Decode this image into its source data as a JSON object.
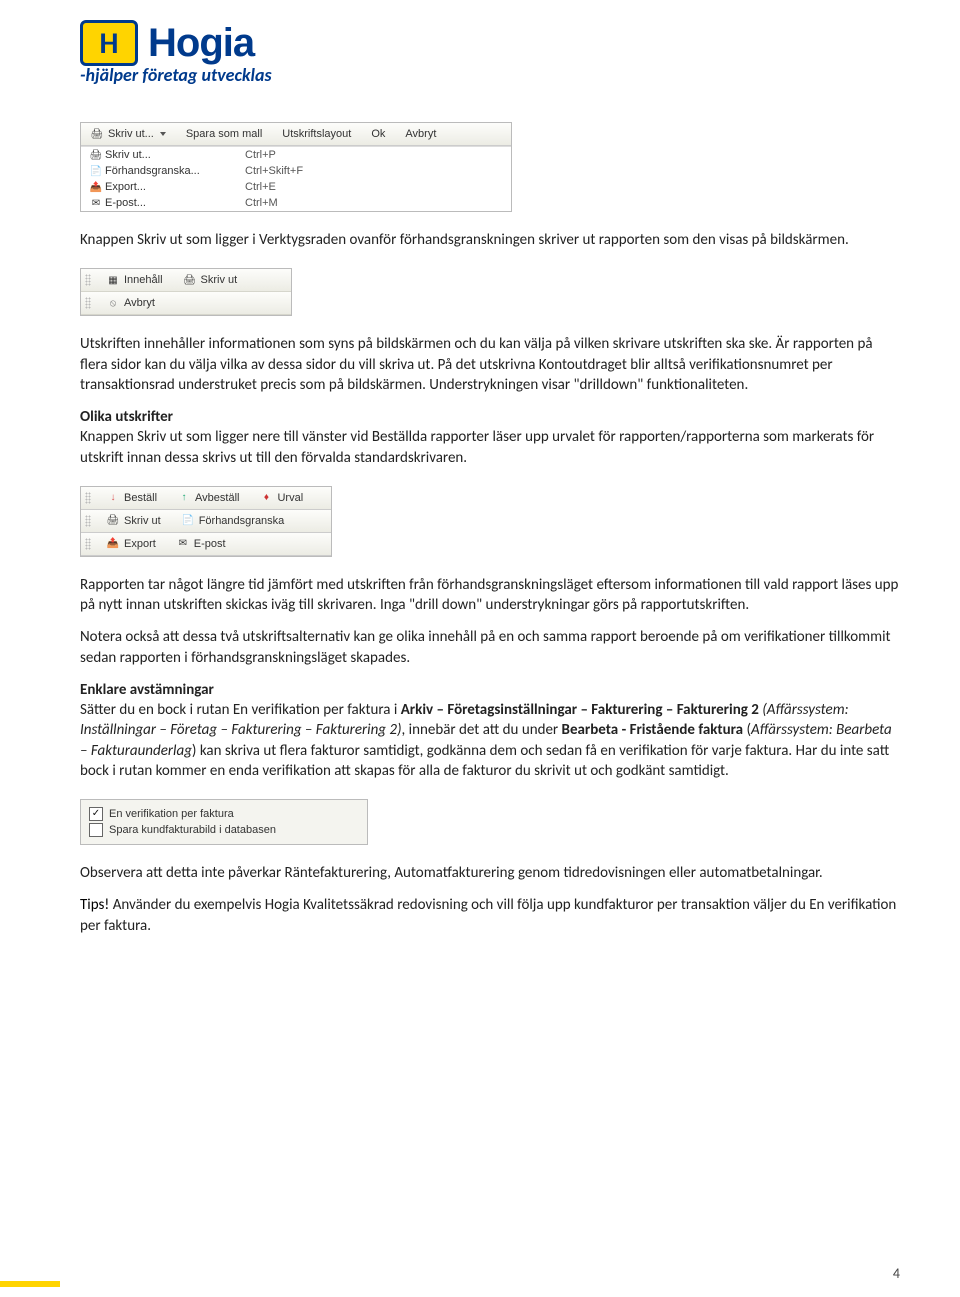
{
  "logo": {
    "brand": "Hogia",
    "slogan": "-hjälper företag utvecklas"
  },
  "shot1": {
    "toolbar": [
      "Skriv ut...",
      "Spara som mall",
      "Utskriftslayout",
      "Ok",
      "Avbryt"
    ],
    "menu": [
      {
        "label": "Skriv ut...",
        "shortcut": "Ctrl+P",
        "icon": "printer"
      },
      {
        "label": "Förhandsgranska...",
        "shortcut": "Ctrl+Skift+F",
        "icon": "doc"
      },
      {
        "label": "Export...",
        "shortcut": "Ctrl+E",
        "icon": "export"
      },
      {
        "label": "E-post...",
        "shortcut": "Ctrl+M",
        "icon": "mail"
      }
    ]
  },
  "para1": "Knappen Skriv ut som ligger i Verktygsraden ovanför förhandsgranskningen skriver ut rapporten som den visas på bildskärmen.",
  "shot2": {
    "row1": [
      "Innehåll",
      "Skriv ut"
    ],
    "row2": [
      "Avbryt"
    ]
  },
  "para2": "Utskriften innehåller informationen som syns på bildskärmen och du kan välja på vilken skrivare utskriften ska ske. Är rapporten på flera sidor kan du välja vilka av dessa sidor du vill skriva ut. På det utskrivna Kontoutdraget blir alltså verifikationsnumret per transaktionsrad understruket precis som på bildskärmen. Understrykningen visar \"drilldown\" funktionaliteten.",
  "heading_olika": "Olika utskrifter",
  "para3": "Knappen Skriv ut som ligger nere till vänster vid Beställda rapporter läser upp urvalet för rapporten/rapporterna som markerats för utskrift innan dessa skrivs ut till den förvalda standardskrivaren.",
  "shot3": {
    "row1": [
      "Beställ",
      "Avbeställ",
      "Urval"
    ],
    "row2": [
      "Skriv ut",
      "Förhandsgranska"
    ],
    "row3": [
      "Export",
      "E-post"
    ]
  },
  "para4": "Rapporten tar något längre tid jämfört med utskriften från förhandsgranskningsläget eftersom informationen till vald rapport läses upp på nytt innan utskriften skickas iväg till skrivaren. Inga \"drill down\" understrykningar görs på rapportutskriften.",
  "para5": "Notera också att dessa två utskriftsalternativ kan ge olika innehåll på en och samma rapport beroende på om verifikationer tillkommit sedan rapporten i förhandsgranskningsläget skapades.",
  "heading_enklare": "Enklare avstämningar",
  "para6_parts": {
    "a": "Sätter du en bock i rutan En verifikation per faktura i ",
    "b": "Arkiv – Företagsinställningar – Fakturering – Fakturering 2",
    "c": " (Affärssystem: Inställningar – Företag – Fakturering – Fakturering 2)",
    "d": ", innebär det att du under ",
    "e": "Bearbeta - Fristående faktura",
    "f": " (",
    "g": "Affärssystem: Bearbeta – Fakturaunderlag",
    "h": ") kan skriva ut flera fakturor samtidigt, godkänna dem och sedan få en verifikation för varje faktura. Har du inte satt bock i rutan kommer en enda verifikation att skapas för alla de fakturor du skrivit ut och godkänt samtidigt."
  },
  "shot4": {
    "opts": [
      {
        "checked": true,
        "label": "En verifikation per faktura"
      },
      {
        "checked": false,
        "label": "Spara kundfakturabild i databasen"
      }
    ]
  },
  "para7": "Observera att detta inte påverkar Räntefakturering, Automatfakturering genom tidredovisningen eller automatbetalningar.",
  "para8_parts": {
    "a": "Tips!",
    "b": " Använder du exempelvis Hogia Kvalitetssäkrad redovisning och vill följa upp kundfakturor per transaktion väljer du En verifikation per faktura."
  },
  "page_number": "4"
}
